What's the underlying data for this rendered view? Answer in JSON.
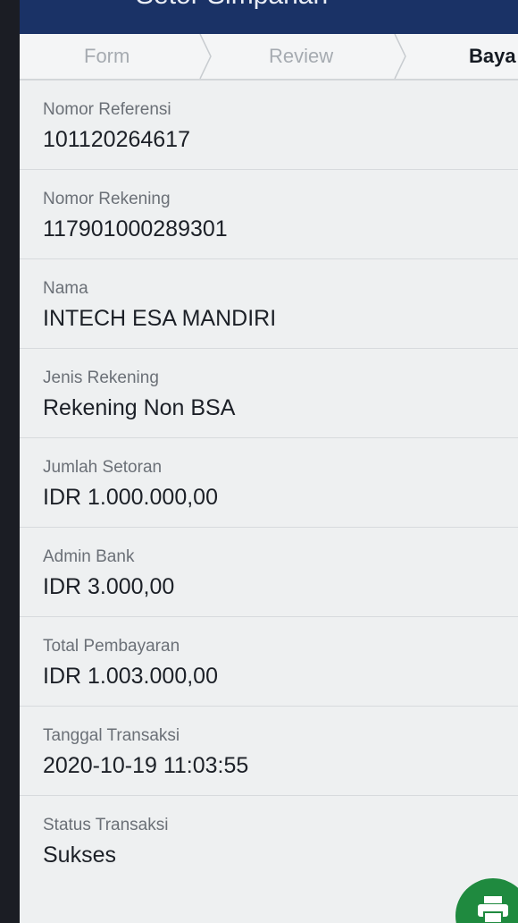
{
  "header": {
    "title": "Setor Simpanan"
  },
  "stepper": {
    "steps": [
      "Form",
      "Review",
      "Baya"
    ],
    "active_index": 2
  },
  "details": [
    {
      "label": "Nomor Referensi",
      "value": "101120264617"
    },
    {
      "label": "Nomor Rekening",
      "value": "117901000289301"
    },
    {
      "label": "Nama",
      "value": "INTECH ESA MANDIRI"
    },
    {
      "label": "Jenis Rekening",
      "value": "Rekening Non BSA"
    },
    {
      "label": "Jumlah Setoran",
      "value": "IDR 1.000.000,00"
    },
    {
      "label": "Admin Bank",
      "value": "IDR 3.000,00"
    },
    {
      "label": "Total Pembayaran",
      "value": "IDR 1.003.000,00"
    },
    {
      "label": "Tanggal Transaksi",
      "value": "2020-10-19 11:03:55"
    },
    {
      "label": "Status Transaksi",
      "value": "Sukses"
    }
  ],
  "fab": {
    "icon": "print-icon",
    "color": "#1f8a3f"
  },
  "colors": {
    "appbar": "#1a3266",
    "background": "#eef0f1"
  }
}
